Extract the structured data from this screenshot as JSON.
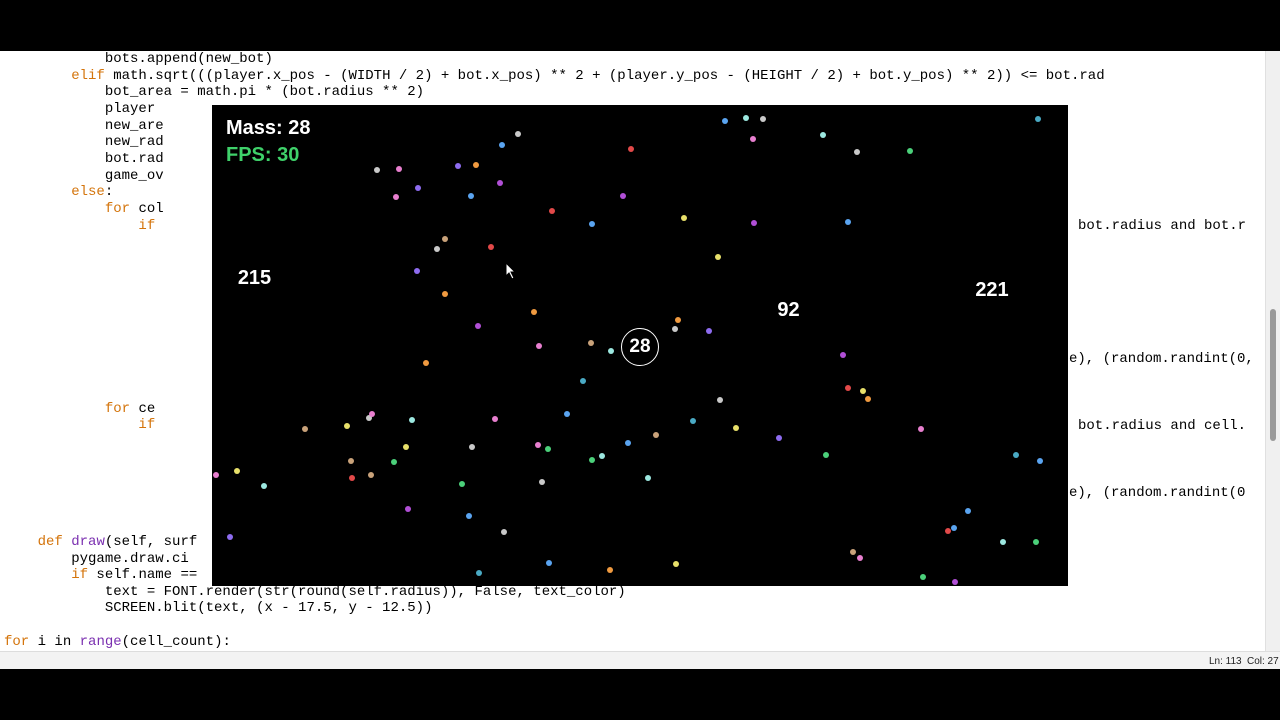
{
  "editor": {
    "lines": [
      {
        "text": "            bots.append(new_bot)"
      },
      {
        "text": "        elif math.sqrt(((player.x_pos - (WIDTH / 2) + bot.x_pos) ** 2 + (player.y_pos - (HEIGHT / 2) + bot.y_pos) ** 2)) <= bot.rad",
        "kw": "elif"
      },
      {
        "text": "            bot_area = math.pi * (bot.radius ** 2)"
      },
      {
        "text": "            player"
      },
      {
        "text": "            new_are"
      },
      {
        "text": "            new_rad"
      },
      {
        "text": "            bot.rad"
      },
      {
        "text": "            game_ov"
      },
      {
        "text": "        else:",
        "kw": "else"
      },
      {
        "text": "            for col",
        "kw": "for"
      },
      {
        "text": "                if",
        "kw": "if"
      },
      {
        "text": ""
      },
      {
        "text": ""
      },
      {
        "text": ""
      },
      {
        "text": ""
      },
      {
        "text": ""
      },
      {
        "text": ""
      },
      {
        "text": ""
      },
      {
        "text": ""
      },
      {
        "text": ""
      },
      {
        "text": ""
      },
      {
        "text": "            for ce",
        "kw": "for"
      },
      {
        "text": "                if",
        "kw": "if"
      },
      {
        "text": ""
      },
      {
        "text": ""
      },
      {
        "text": ""
      },
      {
        "text": ""
      },
      {
        "text": ""
      },
      {
        "text": ""
      },
      {
        "text": "    def draw(self, surf",
        "kw": "def",
        "fn": "draw"
      },
      {
        "text": "        pygame.draw.ci"
      },
      {
        "text": "        if self.name ==",
        "kw": "if"
      },
      {
        "text": "            text = FONT.render(str(round(self.radius)), False, text_color)"
      },
      {
        "text": "            SCREEN.blit(text, (x - 17.5, y - 12.5))"
      },
      {
        "text": ""
      },
      {
        "text": "for i in range(cell_count):",
        "kw": "for",
        "fn": "range"
      }
    ],
    "right_fragments": [
      "bot.radius and bot.r",
      "e), (random.randint(0,",
      "bot.radius and cell.",
      "e), (random.randint(0"
    ]
  },
  "status": {
    "line": "Ln: 113",
    "col": "Col: 27"
  },
  "game": {
    "mass_text": "Mass: 28",
    "fps_text": "FPS: 30",
    "cells": [
      {
        "label": "215",
        "color": "#5a3fd2"
      },
      {
        "label": "221",
        "color": "#41b7e2"
      },
      {
        "label": "92",
        "color": "#b1e852"
      },
      {
        "label": "28",
        "color": "#e51414"
      }
    ],
    "pellet_colors": [
      "#e8e06a",
      "#8e6cf0",
      "#e24949",
      "#4bd07a",
      "#5aa4f0",
      "#e87fcf",
      "#c9a27a",
      "#9ce8e0",
      "#c9c9c9",
      "#f09a40",
      "#4aaac4",
      "#b14fd6"
    ]
  }
}
